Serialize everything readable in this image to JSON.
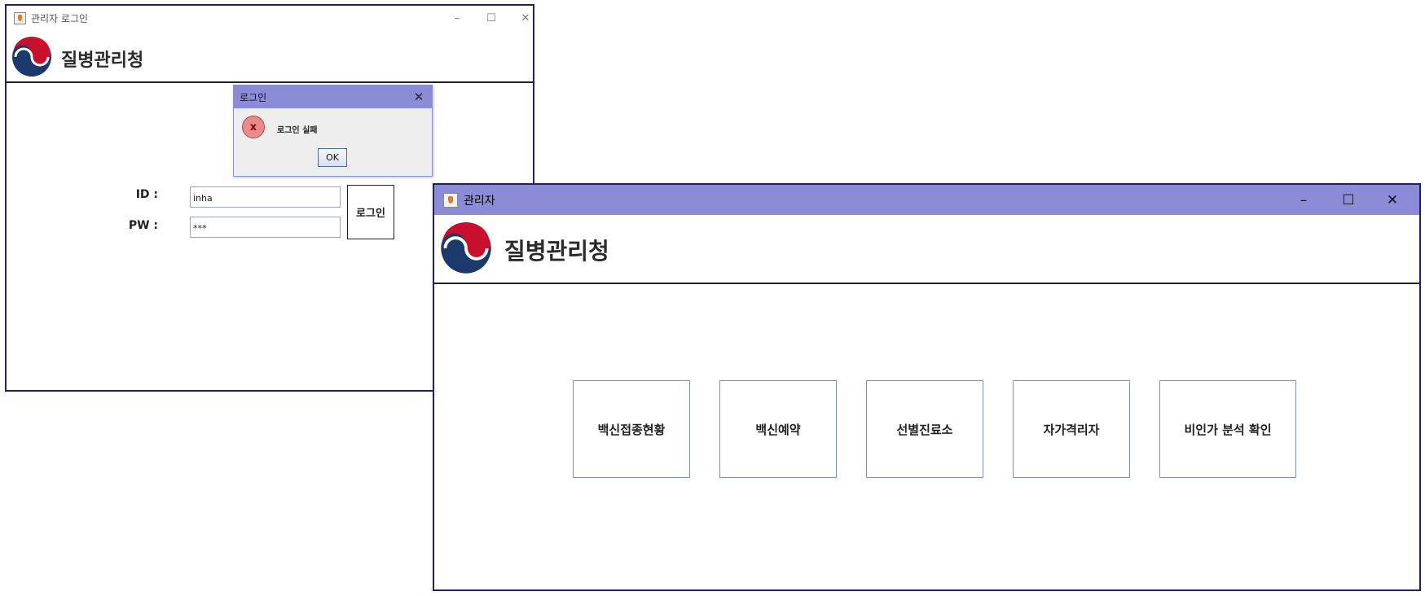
{
  "login_window": {
    "title": "관리자 로그인",
    "logo_text": "질병관리청",
    "controls": {
      "minimize": "–",
      "maximize": "☐",
      "close": "✕"
    },
    "id_label": "ID :",
    "pw_label": "PW :",
    "id_value": "inha",
    "pw_value": "***",
    "login_button": "로그인"
  },
  "dialog": {
    "title": "로그인",
    "close": "✕",
    "icon": "error-icon",
    "icon_glyph": "x",
    "message": "로그인 실패",
    "ok_button": "OK"
  },
  "admin_window": {
    "title": "관리자",
    "logo_text": "질병관리청",
    "controls": {
      "minimize": "–",
      "maximize": "☐",
      "close": "✕"
    },
    "menu": [
      {
        "label": "백신접종현황"
      },
      {
        "label": "백신예약"
      },
      {
        "label": "선별진료소"
      },
      {
        "label": "자가격리자"
      },
      {
        "label": "비인가 분석 확인"
      }
    ]
  },
  "colors": {
    "window_border": "#1f1f6e",
    "titlebar_active": "#8b8bd8",
    "logo_navy": "#1b3a6b",
    "logo_red": "#c8102e"
  }
}
